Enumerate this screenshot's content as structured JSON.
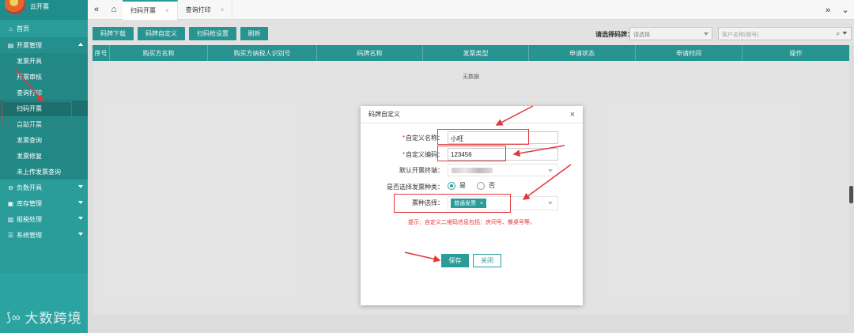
{
  "app": {
    "title": "云开票"
  },
  "sidebar": {
    "home": "首页",
    "groups": [
      {
        "label": "开票管理",
        "items": [
          "发票开具",
          "开票审核",
          "查询打印",
          "扫码开票",
          "自助开票",
          "发票查询",
          "发票修复",
          "未上传发票查询"
        ]
      },
      {
        "label": "负数开具"
      },
      {
        "label": "库存管理"
      },
      {
        "label": "报税处理"
      },
      {
        "label": "系统管理"
      }
    ],
    "active_item": "扫码开票"
  },
  "tabs": [
    {
      "label": "扫码开票"
    },
    {
      "label": "查询打印"
    }
  ],
  "toolbar": {
    "buttons": [
      "码牌下载",
      "码牌自定义",
      "扫码枪设置",
      "刷新"
    ],
    "select_label": "请选择码牌：",
    "select_value": "请选择",
    "search_placeholder": "客户名称(税号)"
  },
  "table": {
    "columns": [
      "序号",
      "购买方名称",
      "购买方纳税人识别号",
      "码牌名称",
      "发票类型",
      "申请状态",
      "申请时间",
      "操作"
    ],
    "empty_text": "无数据"
  },
  "modal": {
    "title": "码牌自定义",
    "fields": {
      "name_label": "自定义名称：",
      "name_value": "小旺",
      "code_label": "自定义编码：",
      "code_value": "123456",
      "terminal_label": "默认开票终端：",
      "choose_type_label": "是否选择发票种类：",
      "yes": "是",
      "no": "否",
      "type_label": "票种选择：",
      "type_tag": "普通发票"
    },
    "hint": "提示：自定义二维码信息包括：房间号、餐桌号等。",
    "save": "保存",
    "cancel": "关闭"
  },
  "watermark": "大数跨境",
  "colors": {
    "accent": "#2a9c9a",
    "annotation": "#e0393b",
    "hint": "#e33"
  },
  "icons": {
    "home": "home-icon",
    "menu": "collapse-icon",
    "close": "close-icon",
    "search": "search-icon",
    "filter": "filter-icon"
  }
}
